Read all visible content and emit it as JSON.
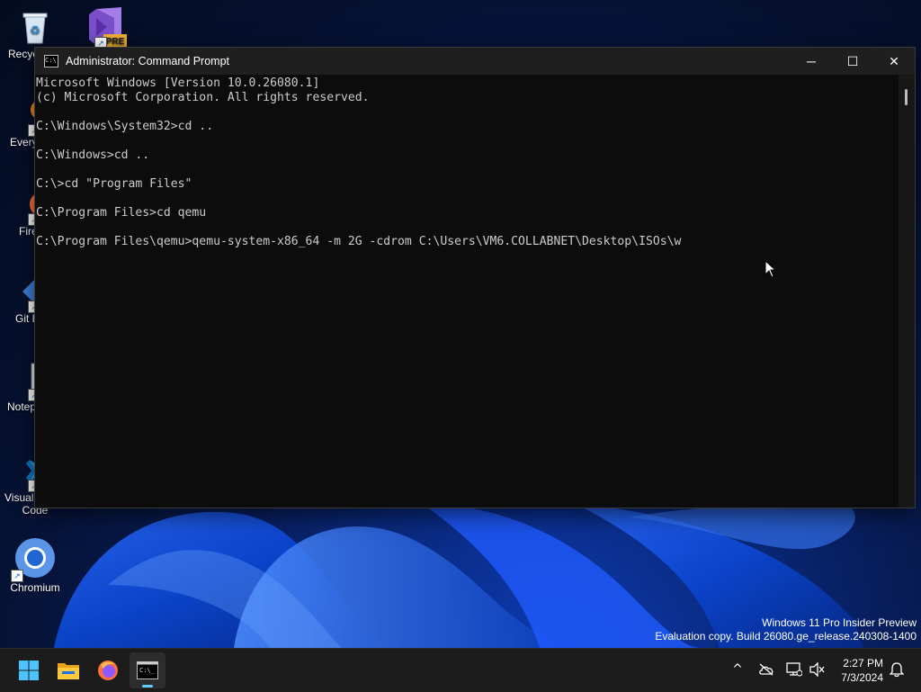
{
  "desktop": {
    "icons": [
      {
        "label": "Recycle Bin",
        "visible_label": "Recyc",
        "icon": "recycle-bin-icon"
      },
      {
        "label": "",
        "visible_label": "",
        "badge": "PRE",
        "icon": "visual-studio-preview-icon"
      },
      {
        "label": "Everything",
        "visible_label": "Every",
        "icon": "everything-search-icon"
      },
      {
        "label": "Firefox",
        "visible_label": "Fire",
        "icon": "firefox-icon"
      },
      {
        "label": "Git Bash",
        "visible_label": "Git E",
        "icon": "git-icon"
      },
      {
        "label": "Notepad++",
        "visible_label": "Notep",
        "icon": "notepad-plus-plus-icon"
      },
      {
        "label": "Visual Studio Code",
        "visible_label_line1": "Visual",
        "visible_label_line2": "Code",
        "icon": "vscode-icon"
      },
      {
        "label": "Chromium",
        "visible_label": "Chromium",
        "icon": "chromium-icon"
      }
    ]
  },
  "window": {
    "title": "Administrator: Command Prompt",
    "controls": {
      "minimize": "─",
      "maximize": "☐",
      "close": "✕"
    },
    "lines": [
      "Microsoft Windows [Version 10.0.26080.1]",
      "(c) Microsoft Corporation. All rights reserved.",
      "",
      "C:\\Windows\\System32>cd ..",
      "",
      "C:\\Windows>cd ..",
      "",
      "C:\\>cd \"Program Files\"",
      "",
      "C:\\Program Files>cd qemu",
      "",
      "C:\\Program Files\\qemu>qemu-system-x86_64 -m 2G -cdrom C:\\Users\\VM6.COLLABNET\\Desktop\\ISOs\\w"
    ]
  },
  "watermark": {
    "line1": "Windows 11 Pro Insider Preview",
    "line2": "Evaluation copy. Build 26080.ge_release.240308-1400"
  },
  "taskbar": {
    "items": [
      {
        "name": "start-button",
        "icon": "windows-logo-icon"
      },
      {
        "name": "file-explorer-button",
        "icon": "folder-icon"
      },
      {
        "name": "firefox-taskbar-button",
        "icon": "firefox-icon"
      },
      {
        "name": "command-prompt-taskbar-button",
        "icon": "terminal-icon",
        "active": true
      }
    ],
    "tray": {
      "chevron": "^",
      "time": "2:27 PM",
      "date": "7/3/2024"
    }
  },
  "colors": {
    "accent": "#60cdff",
    "console_bg": "#0c0c0c",
    "console_text": "#cccccc",
    "titlebar": "#1f1f1f",
    "taskbar": "#1c1c1c"
  }
}
